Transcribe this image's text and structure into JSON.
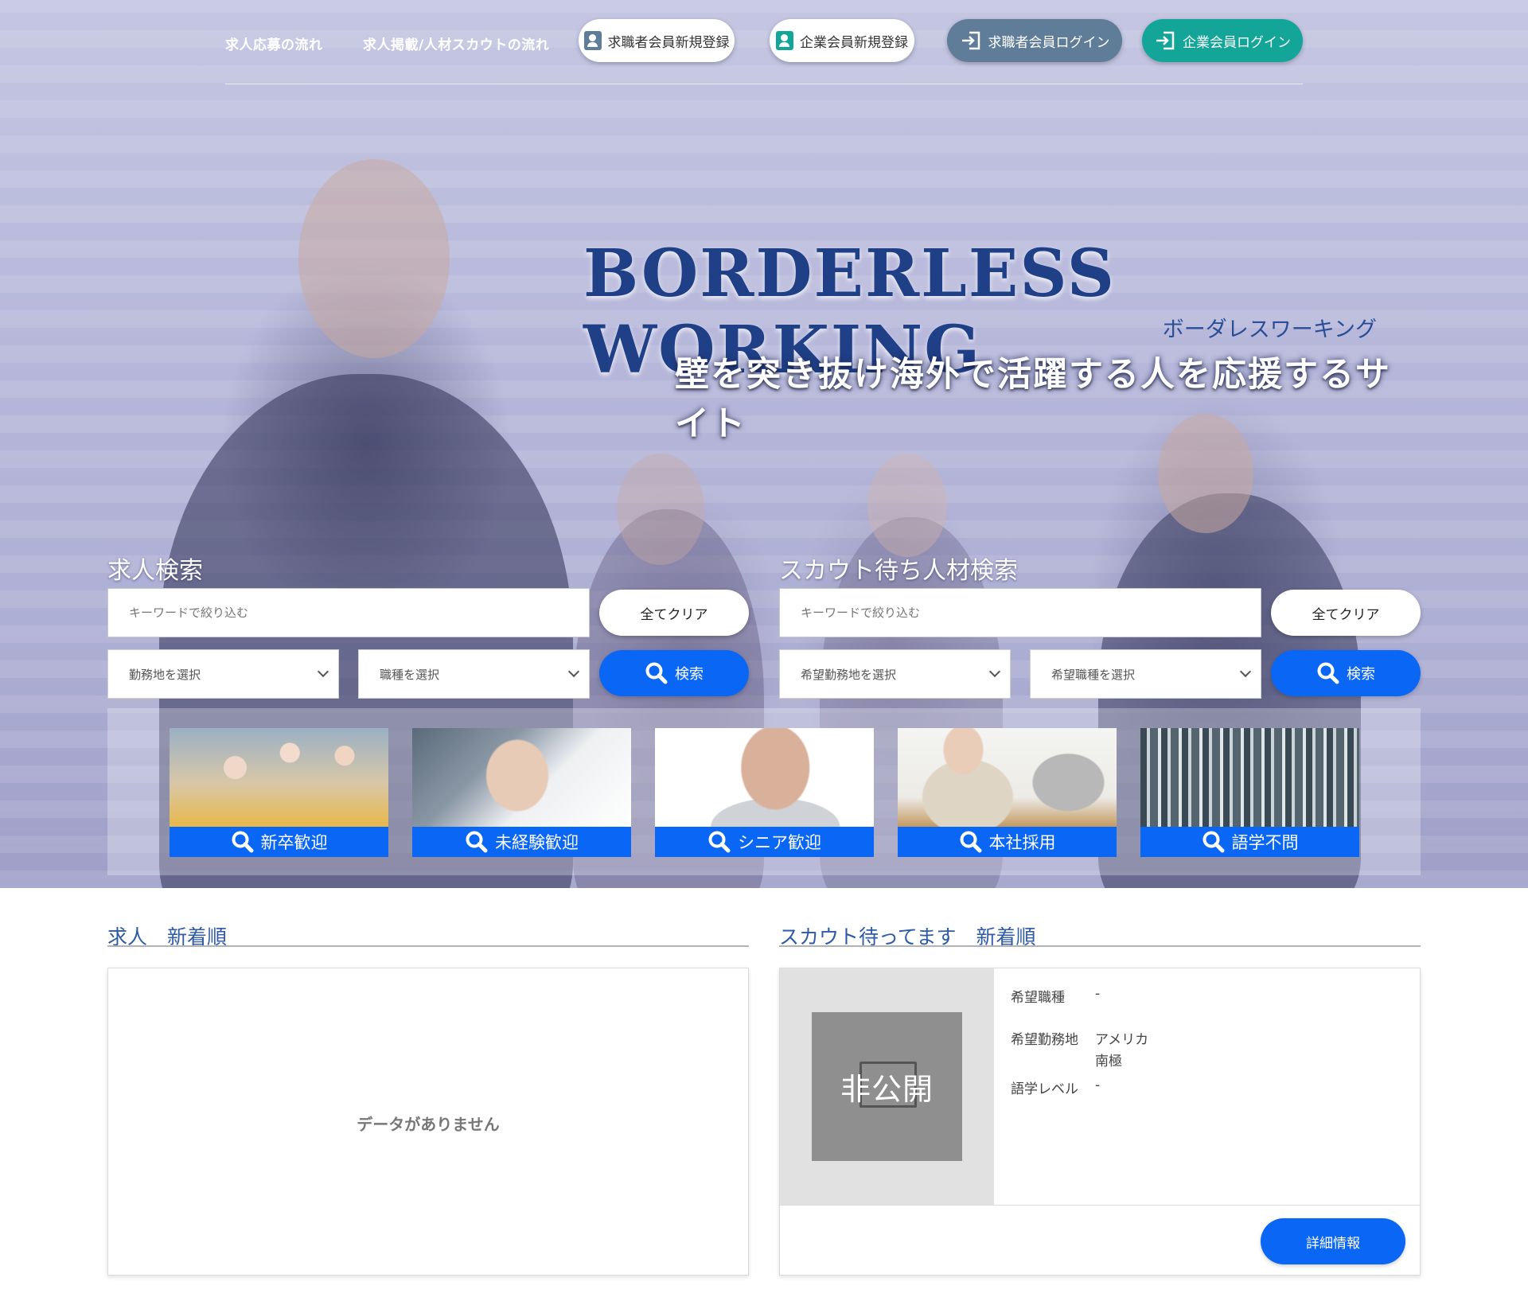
{
  "nav": {
    "link_apply_flow": "求人応募の流れ",
    "link_post_flow": "求人掲載/人材スカウトの流れ",
    "btn_seeker_register": "求職者会員新規登録",
    "btn_company_register": "企業会員新規登録",
    "btn_seeker_login": "求職者会員ログイン",
    "btn_company_login": "企業会員ログイン"
  },
  "hero": {
    "title": "BORDERLESS WORKING",
    "kana": "ボーダレスワーキング",
    "tagline": "壁を突き抜け海外で活躍する人を応援するサイト"
  },
  "job_search": {
    "title": "求人検索",
    "keyword_placeholder": "キーワードで絞り込む",
    "location_select": "勤務地を選択",
    "occupation_select": "職種を選択",
    "clear_label": "全てクリア",
    "search_label": "検索"
  },
  "scout_search": {
    "title": "スカウト待ち人材検索",
    "keyword_placeholder": "キーワードで絞り込む",
    "location_select": "希望勤務地を選択",
    "occupation_select": "希望職種を選択",
    "clear_label": "全てクリア",
    "search_label": "検索"
  },
  "categories": [
    {
      "label": "新卒歓迎",
      "icon": "search-icon"
    },
    {
      "label": "未経験歓迎",
      "icon": "search-icon"
    },
    {
      "label": "シニア歓迎",
      "icon": "search-icon"
    },
    {
      "label": "本社採用",
      "icon": "search-icon"
    },
    {
      "label": "語学不問",
      "icon": "search-icon"
    }
  ],
  "jobs_section": {
    "title": "求人　新着順",
    "empty_text": "データがありません"
  },
  "scout_section": {
    "title": "スカウト待ってます　新着順",
    "card": {
      "image_text": "非公開",
      "occupation_label": "希望職種",
      "occupation_value": "-",
      "location_label": "希望勤務地",
      "location_values": [
        "アメリカ",
        "南極"
      ],
      "language_label": "語学レベル",
      "language_value": "-",
      "detail_button": "詳細情報"
    }
  },
  "colors": {
    "primary_blue": "#0a66f5",
    "steel_button": "#5f7d99",
    "teal_button": "#12a598",
    "section_title": "#2e5aa8"
  }
}
